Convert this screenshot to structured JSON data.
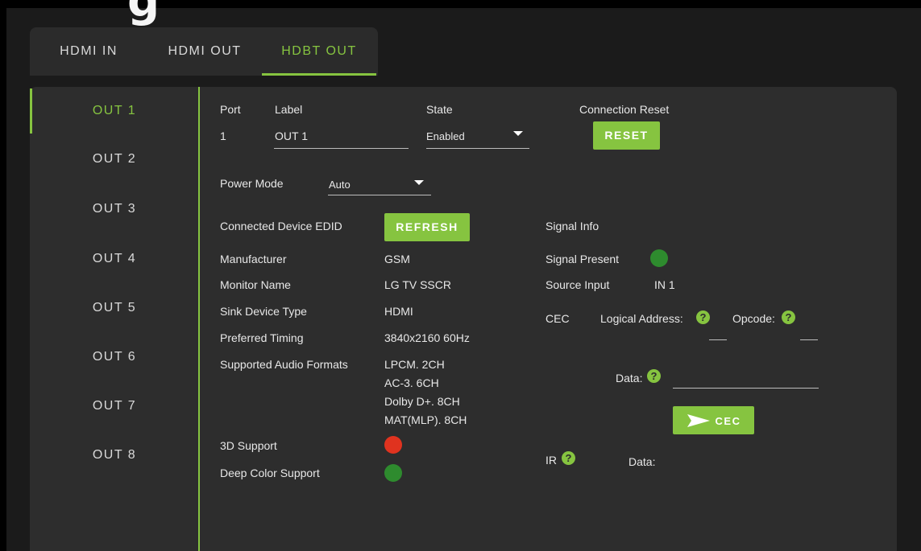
{
  "page_heading_fragment": "g",
  "tabs": [
    {
      "label": "HDMI IN"
    },
    {
      "label": "HDMI OUT"
    },
    {
      "label": "HDBT OUT"
    }
  ],
  "active_tab": "HDBT OUT",
  "outputs": [
    {
      "label": "OUT 1"
    },
    {
      "label": "OUT 2"
    },
    {
      "label": "OUT 3"
    },
    {
      "label": "OUT 4"
    },
    {
      "label": "OUT 5"
    },
    {
      "label": "OUT 6"
    },
    {
      "label": "OUT 7"
    },
    {
      "label": "OUT 8"
    }
  ],
  "active_output": "OUT 1",
  "port": {
    "port_header": "Port",
    "port_value": "1",
    "label_header": "Label",
    "label_value": "OUT 1",
    "state_header": "State",
    "state_value": "Enabled",
    "reset_header": "Connection Reset",
    "reset_button": "RESET"
  },
  "power": {
    "label": "Power Mode",
    "value": "Auto"
  },
  "edid": {
    "title": "Connected Device EDID",
    "refresh_button": "REFRESH",
    "manufacturer_label": "Manufacturer",
    "manufacturer_value": "GSM",
    "monitor_label": "Monitor Name",
    "monitor_value": "LG TV SSCR",
    "sink_label": "Sink Device Type",
    "sink_value": "HDMI",
    "timing_label": "Preferred Timing",
    "timing_value": "3840x2160 60Hz",
    "audio_label": "Supported Audio Formats",
    "audio_formats": [
      "LPCM. 2CH",
      "AC-3. 6CH",
      "Dolby D+. 8CH",
      "MAT(MLP). 8CH"
    ],
    "support_3d_label": "3D Support",
    "support_3d": false,
    "deep_color_label": "Deep Color Support",
    "deep_color": true
  },
  "signal": {
    "title": "Signal Info",
    "present_label": "Signal Present",
    "present": true,
    "source_label": "Source Input",
    "source_value": "IN 1"
  },
  "cec": {
    "label": "CEC",
    "logical_address_label": "Logical Address:",
    "opcode_label": "Opcode:",
    "data_label": "Data:",
    "send_button": "CEC",
    "help_glyph": "?"
  },
  "ir": {
    "label": "IR",
    "data_label": "Data:"
  },
  "colors": {
    "accent": "#86c440",
    "status_off": "#e0331f",
    "status_on": "#2e8b2e",
    "panel_bg": "#2d2d2d",
    "page_bg": "#1b1b1b"
  },
  "icons": {
    "dropdown": "caret-down-icon",
    "send": "send-arrow-icon",
    "help": "help-circle-icon"
  }
}
